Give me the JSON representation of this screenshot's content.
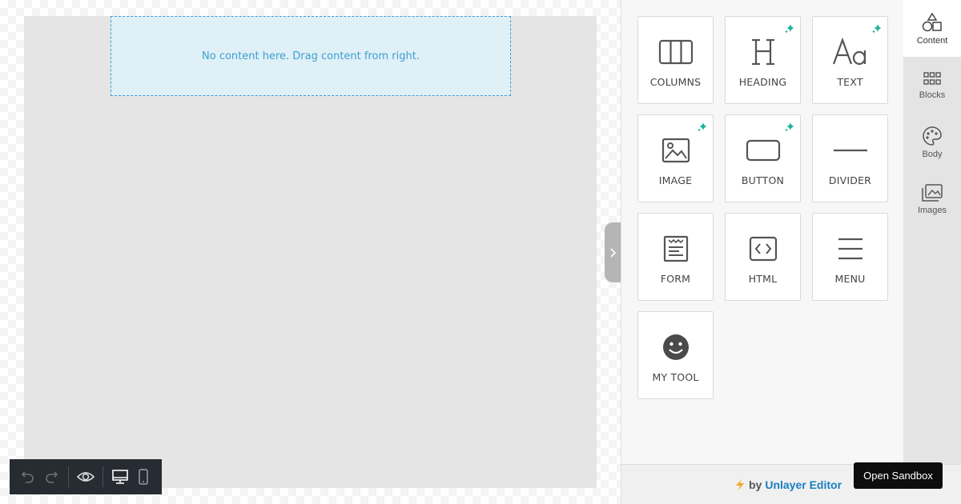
{
  "canvas": {
    "empty_message": "No content here. Drag content from right."
  },
  "toolbar": {
    "buttons": [
      "undo-icon",
      "redo-icon",
      "eye-icon",
      "desktop-icon",
      "mobile-icon"
    ]
  },
  "content_tools": [
    {
      "label": "COLUMNS",
      "icon": "columns-icon",
      "sparkle": false
    },
    {
      "label": "HEADING",
      "icon": "heading-icon",
      "sparkle": true
    },
    {
      "label": "TEXT",
      "icon": "text-icon",
      "sparkle": true
    },
    {
      "label": "IMAGE",
      "icon": "image-icon",
      "sparkle": true
    },
    {
      "label": "BUTTON",
      "icon": "button-icon",
      "sparkle": true
    },
    {
      "label": "DIVIDER",
      "icon": "divider-icon",
      "sparkle": false
    },
    {
      "label": "FORM",
      "icon": "form-icon",
      "sparkle": false
    },
    {
      "label": "HTML",
      "icon": "html-icon",
      "sparkle": false
    },
    {
      "label": "MENU",
      "icon": "menu-icon",
      "sparkle": false
    },
    {
      "label": "MY TOOL",
      "icon": "smiley-icon",
      "sparkle": false
    }
  ],
  "sidebar": {
    "tabs": [
      {
        "label": "Content",
        "icon": "shapes-icon",
        "active": true
      },
      {
        "label": "Blocks",
        "icon": "grid-icon",
        "active": false
      },
      {
        "label": "Body",
        "icon": "palette-icon",
        "active": false
      },
      {
        "label": "Images",
        "icon": "images-icon",
        "active": false
      }
    ]
  },
  "footer": {
    "by": "by",
    "brand": "Unlayer Editor",
    "sandbox_label": "Open Sandbox"
  },
  "colors": {
    "accent": "#1a7fc1",
    "sparkle": "#16b39a",
    "dropzone_border": "#3c9fd0"
  }
}
